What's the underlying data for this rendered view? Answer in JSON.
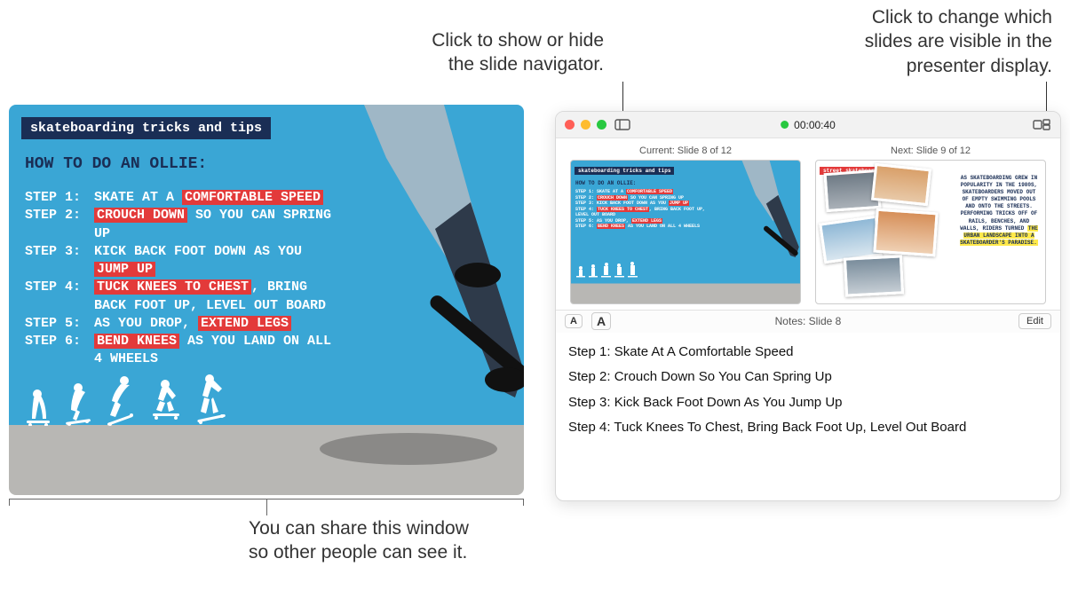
{
  "callouts": {
    "navigator": "Click to show or hide\nthe slide navigator.",
    "layout": "Click to change which\nslides are visible in the\npresenter display.",
    "share": "You can share this window\nso other people can see it."
  },
  "main_slide": {
    "tag": "skateboarding tricks and tips",
    "heading": "HOW TO DO AN OLLIE:",
    "steps": [
      {
        "label": "STEP 1:",
        "pre": "SKATE AT A ",
        "hl": "COMFORTABLE SPEED",
        "post": ""
      },
      {
        "label": "STEP 2:",
        "pre": "",
        "hl": "CROUCH DOWN",
        "post": " SO YOU CAN SPRING UP"
      },
      {
        "label": "STEP 3:",
        "pre": "KICK BACK FOOT DOWN AS YOU ",
        "hl": "JUMP UP",
        "post": ""
      },
      {
        "label": "STEP 4:",
        "pre": "",
        "hl": "TUCK KNEES TO CHEST",
        "post": ", BRING BACK FOOT UP, LEVEL OUT BOARD"
      },
      {
        "label": "STEP 5:",
        "pre": "AS YOU DROP, ",
        "hl": "EXTEND LEGS",
        "post": ""
      },
      {
        "label": "STEP 6:",
        "pre": "",
        "hl": "BEND KNEES",
        "post": " AS YOU LAND ON ALL 4 WHEELS"
      }
    ]
  },
  "presenter": {
    "timer": "00:00:40",
    "current_label": "Current: Slide 8 of 12",
    "next_label": "Next: Slide 9 of 12",
    "next_slide": {
      "tag": "street skateboarding",
      "text_lines_pre": "AS SKATEBOARDING GREW IN POPULARITY IN THE 1980S, SKATEBOARDERS MOVED OUT OF EMPTY SWIMMING POOLS AND ONTO THE STREETS. PERFORMING TRICKS OFF OF RAILS, BENCHES, AND WALLS, RIDERS TURNED ",
      "text_hl": "THE URBAN LANDSCAPE INTO A SKATEBOARDER'S PARADISE.",
      "text_post": ""
    },
    "notes_label": "Notes: Slide 8",
    "edit_label": "Edit",
    "font_small": "A",
    "font_large": "A",
    "notes": [
      "Step 1: Skate At A Comfortable Speed",
      "Step 2: Crouch Down So You Can Spring Up",
      "Step 3: Kick Back Foot Down As You Jump Up",
      "Step 4: Tuck Knees To Chest, Bring Back Foot Up, Level Out Board"
    ]
  }
}
